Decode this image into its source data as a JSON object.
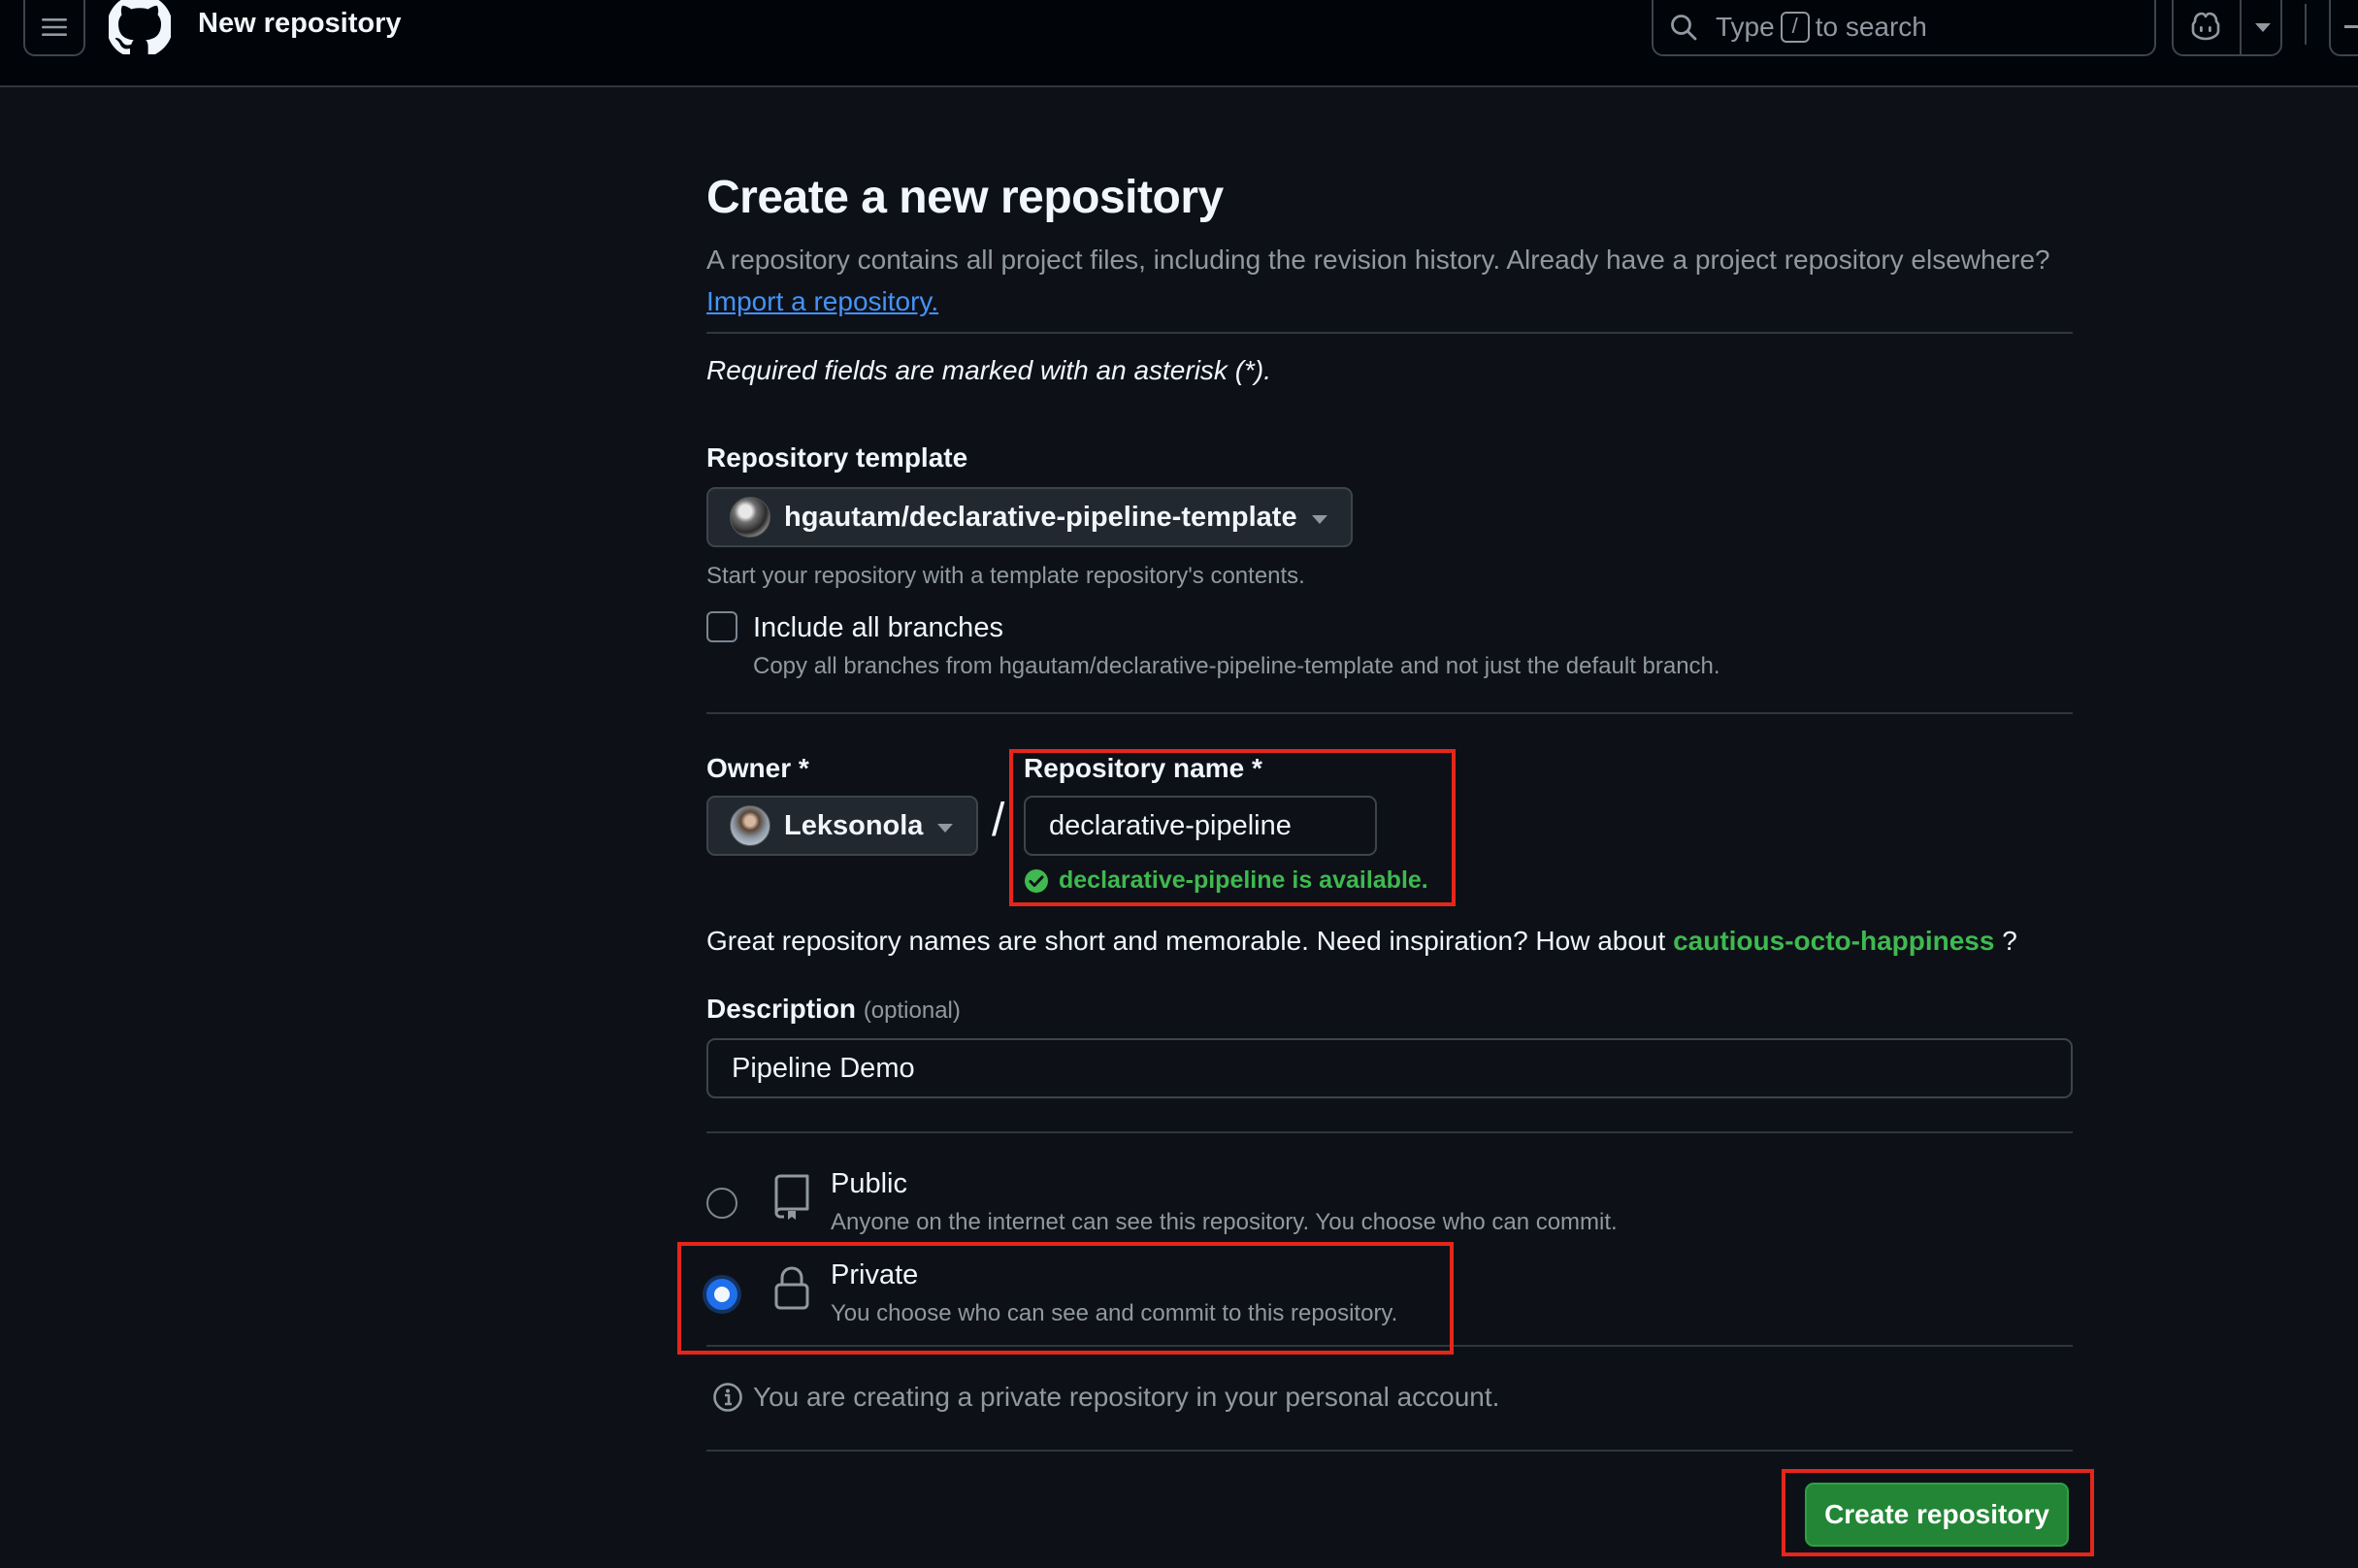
{
  "header": {
    "title": "New repository",
    "search": {
      "prefix": "Type",
      "key": "/",
      "suffix": "to search"
    }
  },
  "page": {
    "title": "Create a new repository",
    "description": "A repository contains all project files, including the revision history. Already have a project repository elsewhere?",
    "import_link": "Import a repository.",
    "required_note": "Required fields are marked with an asterisk (*)."
  },
  "template": {
    "label": "Repository template",
    "selected": "hgautam/declarative-pipeline-template",
    "hint": "Start your repository with a template repository's contents.",
    "include_branches": {
      "label": "Include all branches",
      "hint": "Copy all branches from hgautam/declarative-pipeline-template and not just the default branch.",
      "checked": false
    }
  },
  "owner": {
    "label": "Owner *",
    "selected": "Leksonola",
    "separator": "/"
  },
  "repo_name": {
    "label": "Repository name *",
    "value": "declarative-pipeline",
    "availability": "declarative-pipeline is available."
  },
  "inspiration": {
    "text": "Great repository names are short and memorable. Need inspiration? How about",
    "suggestion": "cautious-octo-happiness",
    "end": "?"
  },
  "description": {
    "label": "Description",
    "optional": "(optional)",
    "value": "Pipeline Demo"
  },
  "visibility": {
    "public": {
      "title": "Public",
      "desc": "Anyone on the internet can see this repository. You choose who can commit.",
      "checked": false
    },
    "private": {
      "title": "Private",
      "desc": "You choose who can see and commit to this repository.",
      "checked": true
    },
    "info": "You are creating a private repository in your personal account."
  },
  "actions": {
    "create_label": "Create repository"
  },
  "colors": {
    "background": "#0d1117",
    "header": "#010409",
    "success": "#3fb950",
    "primary_button": "#238636",
    "link": "#4493f8",
    "radio_accent": "#1f6feb",
    "annotation": "#e5261b"
  }
}
